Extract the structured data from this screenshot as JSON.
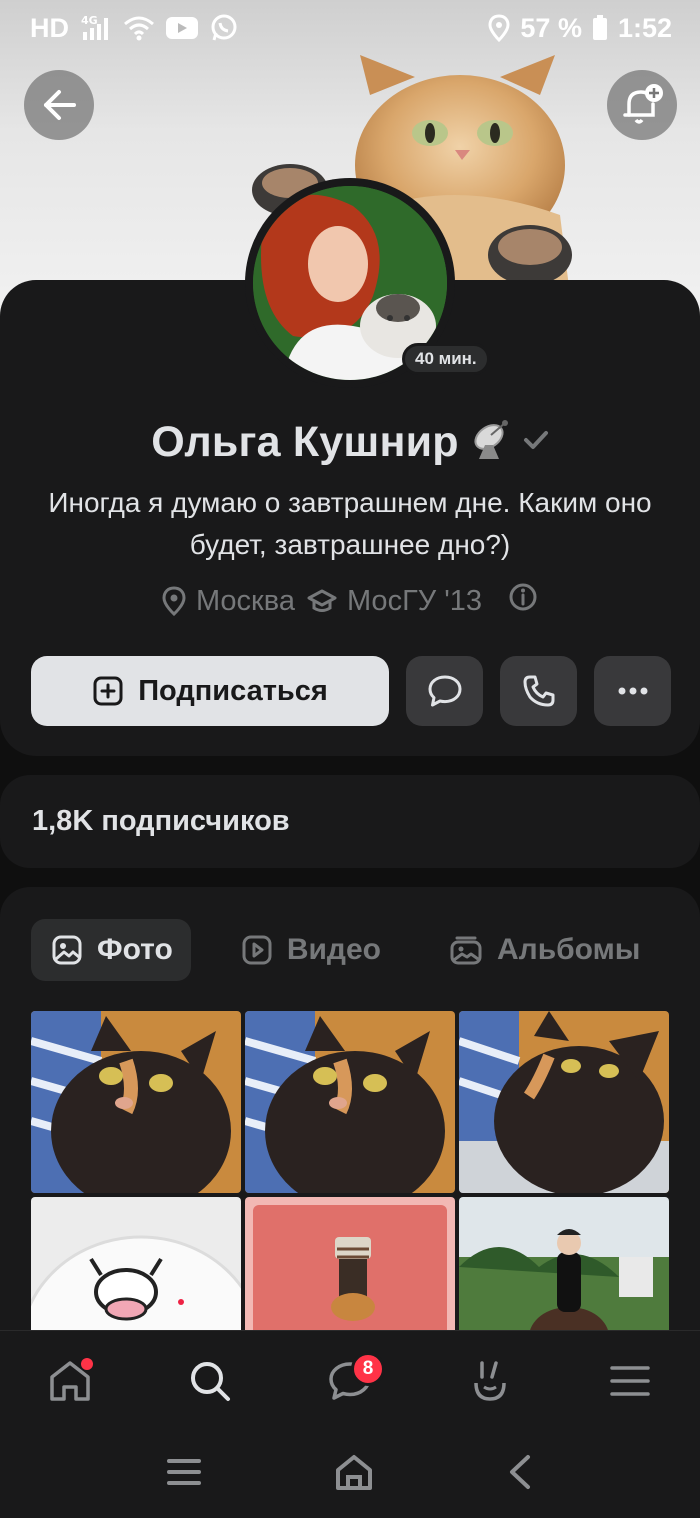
{
  "status_bar": {
    "network": "HD",
    "network_sub": "4G",
    "battery_percent": "57 %",
    "time": "1:52"
  },
  "profile": {
    "name": "Ольга Кушнир",
    "status": "Иногда я думаю о завтрашнем дне. Каким оно будет, завтрашнее дно?)",
    "last_seen": "40 мин.",
    "city": "Москва",
    "education": "МосГУ '13"
  },
  "actions": {
    "subscribe_label": "Подписаться"
  },
  "followers": {
    "label": "1,8K подписчиков"
  },
  "media_tabs": [
    {
      "label": "Фото",
      "active": true,
      "icon": "photo-icon"
    },
    {
      "label": "Видео",
      "active": false,
      "icon": "video-icon"
    },
    {
      "label": "Альбомы",
      "active": false,
      "icon": "albums-icon"
    }
  ],
  "bottom_nav": {
    "items": [
      "home-icon",
      "search-icon",
      "messages-icon",
      "clips-icon",
      "menu-icon"
    ],
    "messages_count": "8"
  },
  "colors": {
    "background": "#0f0f0f",
    "card": "#19191a",
    "text_primary": "#e1e3e6",
    "text_secondary": "#76787a",
    "button_secondary": "#39393b",
    "badge_red": "#ff3347"
  }
}
